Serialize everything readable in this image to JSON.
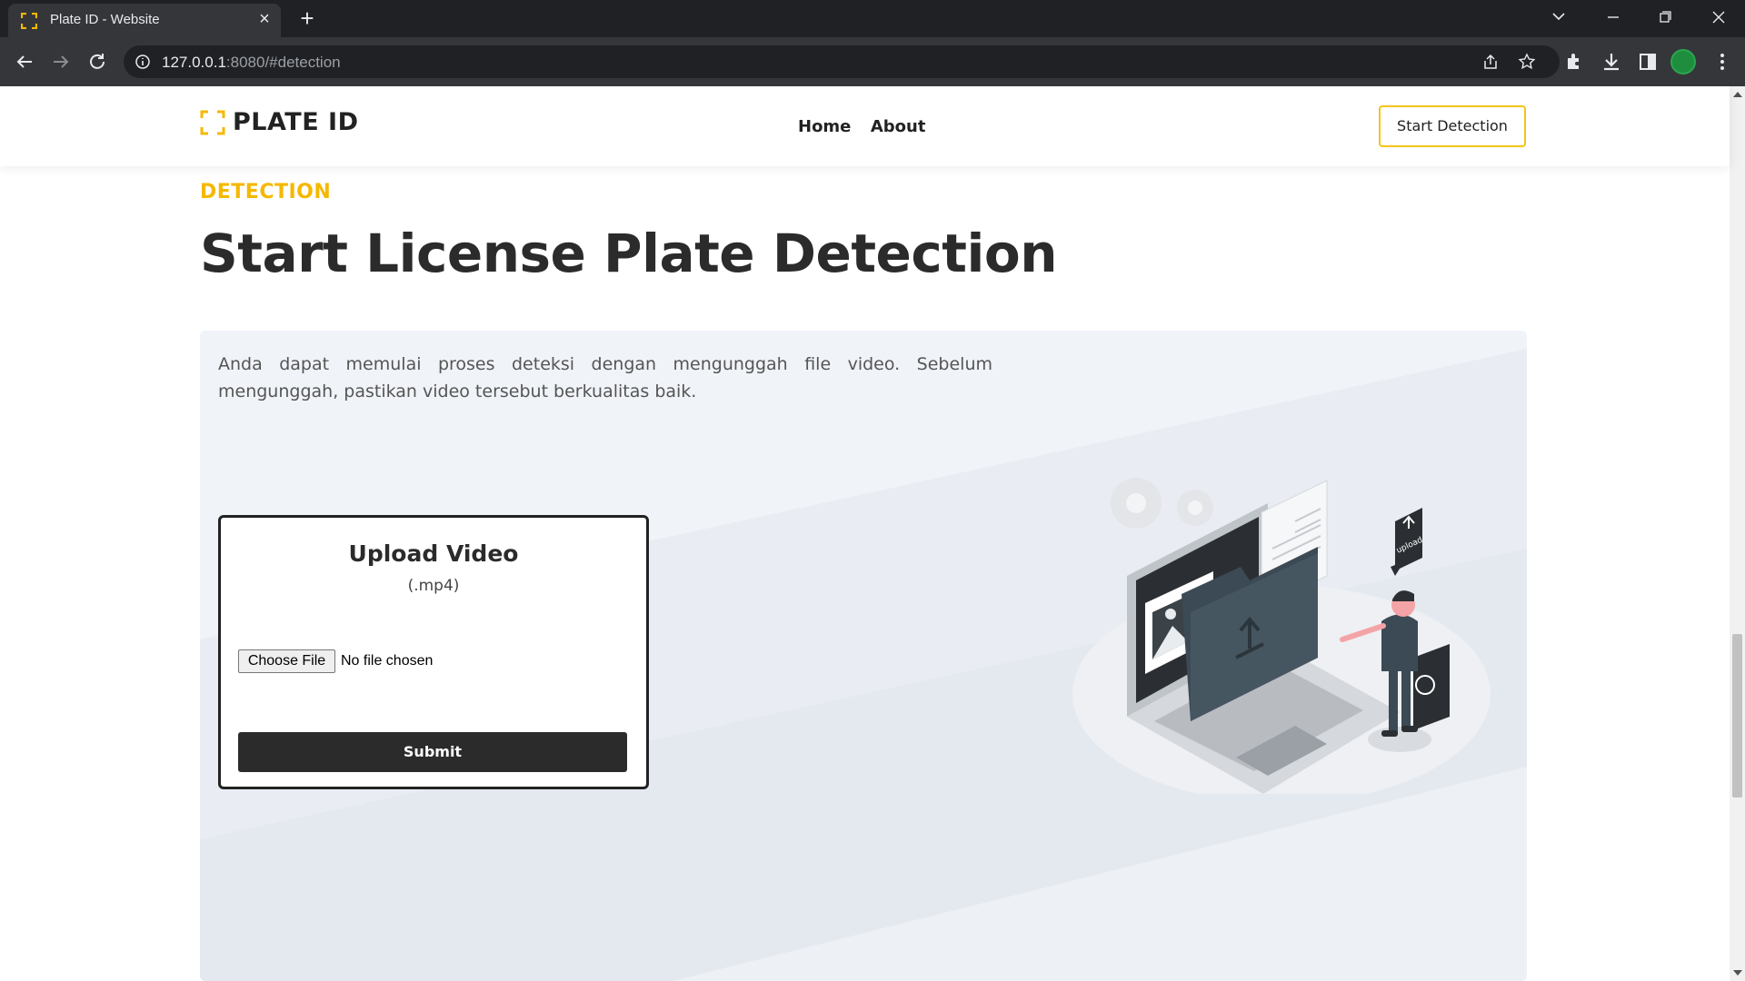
{
  "browser": {
    "tab_title": "Plate ID - Website",
    "url_host": "127.0.0.1",
    "url_rest": ":8080/#detection",
    "icons": [
      "back-icon",
      "forward-icon",
      "reload-icon",
      "info-icon",
      "share-icon",
      "star-icon",
      "extensions-icon",
      "download-icon",
      "side-panel-icon",
      "profile-avatar",
      "menu-icon"
    ]
  },
  "header": {
    "logo_text": "PLATE ID",
    "nav": [
      "Home",
      "About"
    ],
    "cta": "Start Detection"
  },
  "section": {
    "eyebrow": "DETECTION",
    "title": "Start License Plate Detection",
    "intro": "Anda dapat memulai proses deteksi dengan mengunggah file video. Sebelum mengunggah, pastikan video tersebut berkualitas baik."
  },
  "upload": {
    "title": "Upload Video",
    "subtitle": "(.mp4)",
    "file_button": "Choose File",
    "file_status": "No file chosen",
    "submit": "Submit"
  },
  "illustration": {
    "badge_text": "upload"
  },
  "colors": {
    "accent": "#f5b800",
    "dark": "#2b2b2b",
    "panel": "#f0f3f8"
  }
}
